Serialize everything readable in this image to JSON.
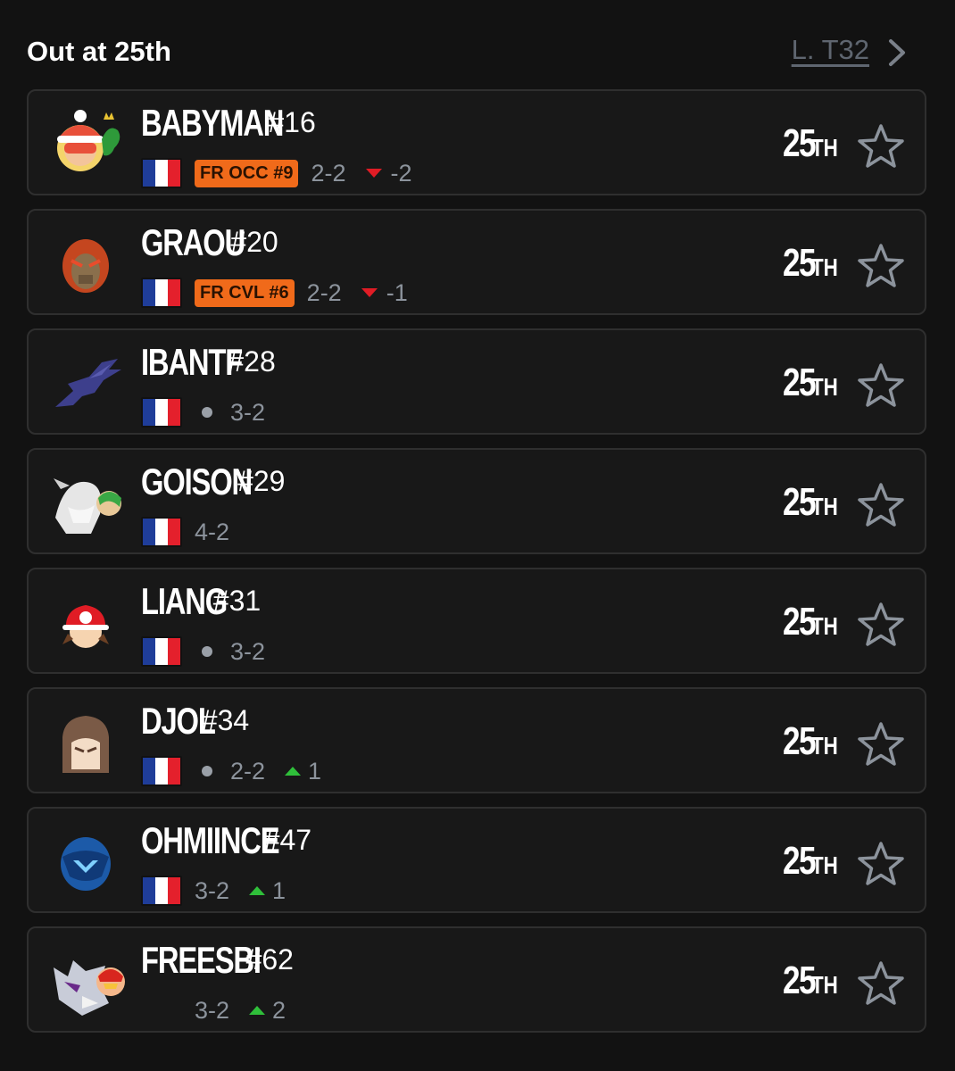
{
  "header": {
    "title": "Out at 25th",
    "round_link": "L. T32"
  },
  "players": [
    {
      "tag": "BABYMAN",
      "seed": "#16",
      "flag": true,
      "badge": "FR OCC #9",
      "dot": false,
      "record": "2-2",
      "trend": "down",
      "trend_value": "-2",
      "placement": "25",
      "suffix": "TH",
      "avatar": "min-min-icon"
    },
    {
      "tag": "GRAOU",
      "seed": "#20",
      "flag": true,
      "badge": "FR CVL #6",
      "dot": false,
      "record": "2-2",
      "trend": "down",
      "trend_value": "-1",
      "placement": "25",
      "suffix": "TH",
      "avatar": "ganondorf-icon"
    },
    {
      "tag": "IBANTF",
      "seed": "#28",
      "flag": true,
      "badge": "",
      "dot": true,
      "record": "3-2",
      "trend": "",
      "trend_value": "",
      "placement": "25",
      "suffix": "TH",
      "avatar": "ridley-icon"
    },
    {
      "tag": "GOISON",
      "seed": "#29",
      "flag": true,
      "badge": "",
      "dot": false,
      "record": "4-2",
      "trend": "",
      "trend_value": "",
      "placement": "25",
      "suffix": "TH",
      "avatar": "corrin-icon"
    },
    {
      "tag": "LIANG",
      "seed": "#31",
      "flag": true,
      "badge": "",
      "dot": true,
      "record": "3-2",
      "trend": "",
      "trend_value": "",
      "placement": "25",
      "suffix": "TH",
      "avatar": "pokemon-trainer-icon"
    },
    {
      "tag": "DJOL",
      "seed": "#34",
      "flag": true,
      "badge": "",
      "dot": true,
      "record": "2-2",
      "trend": "up",
      "trend_value": "1",
      "placement": "25",
      "suffix": "TH",
      "avatar": "kazuya-icon"
    },
    {
      "tag": "OHMIINCE",
      "seed": "#47",
      "flag": true,
      "badge": "",
      "dot": false,
      "record": "3-2",
      "trend": "up",
      "trend_value": "1",
      "placement": "25",
      "suffix": "TH",
      "avatar": "dark-samus-icon"
    },
    {
      "tag": "FREESBI",
      "seed": "#62",
      "flag": false,
      "badge": "",
      "dot": false,
      "record": "3-2",
      "trend": "up",
      "trend_value": "2",
      "placement": "25",
      "suffix": "TH",
      "avatar": "wolf-icon"
    }
  ],
  "colors": {
    "background": "#121212",
    "card": "#181818",
    "badge": "#f06a1a",
    "down": "#e01c25",
    "up": "#2fbf3a"
  }
}
